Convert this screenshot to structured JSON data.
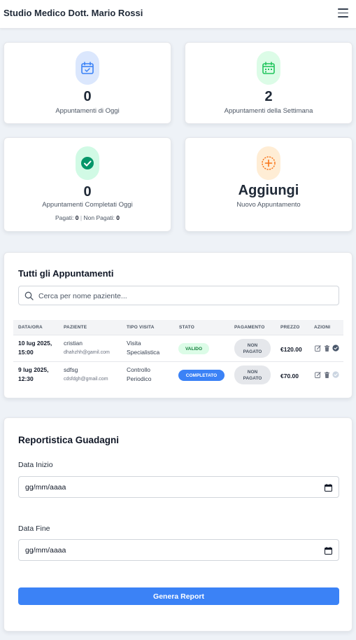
{
  "navbar": {
    "title": "Studio Medico Dott. Mario Rossi",
    "menu_icon": "hamburger-icon"
  },
  "stats": {
    "today": {
      "value": "0",
      "label": "Appuntamenti di Oggi",
      "icon": "calendar-check-icon",
      "color": "#3b82f6"
    },
    "week": {
      "value": "2",
      "label": "Appuntamenti della Settimana",
      "icon": "calendar-week-icon",
      "color": "#22c55e"
    },
    "completed": {
      "value": "0",
      "label": "Appuntamenti Completati Oggi",
      "icon": "check-circle-icon",
      "color": "#059669",
      "paid_label": "Pagati:",
      "paid_value": "0",
      "separator": "|",
      "unpaid_label": "Non Pagati:",
      "unpaid_value": "0"
    },
    "add": {
      "value": "Aggiungi",
      "label": "Nuovo Appuntamento",
      "icon": "plus-circle-icon",
      "color": "#f97316"
    }
  },
  "appointments": {
    "title": "Tutti gli Appuntamenti",
    "search_placeholder": "Cerca per nome paziente...",
    "headers": [
      "DATA/ORA",
      "PAZIENTE",
      "TIPO VISITA",
      "STATO",
      "PAGAMENTO",
      "PREZZO",
      "AZIONI"
    ],
    "rows": [
      {
        "date1": "10 lug 2025,",
        "date2": "15:00",
        "patient": "cristian",
        "email": "dhahzhh@gamil.com",
        "type1": "Visita",
        "type2": "Specialistica",
        "status": "VALIDO",
        "payment1": "NON",
        "payment2": "PAGATO",
        "price": "€120.00"
      },
      {
        "date1": "9 lug 2025,",
        "date2": "12:30",
        "patient": "sdfsg",
        "email": "cdsfdgh@gmail.com",
        "type1": "Controllo",
        "type2": "Periodico",
        "status": "COMPLETATO",
        "payment1": "NON",
        "payment2": "PAGATO",
        "price": "€70.00"
      }
    ]
  },
  "report": {
    "title": "Reportistica Guadagni",
    "start_label": "Data Inizio",
    "start_value": "gg/mm/aaaa",
    "end_label": "Data Fine",
    "end_value": "gg/mm/aaaa",
    "button": "Genera Report",
    "button_color": "#3b82f6"
  }
}
